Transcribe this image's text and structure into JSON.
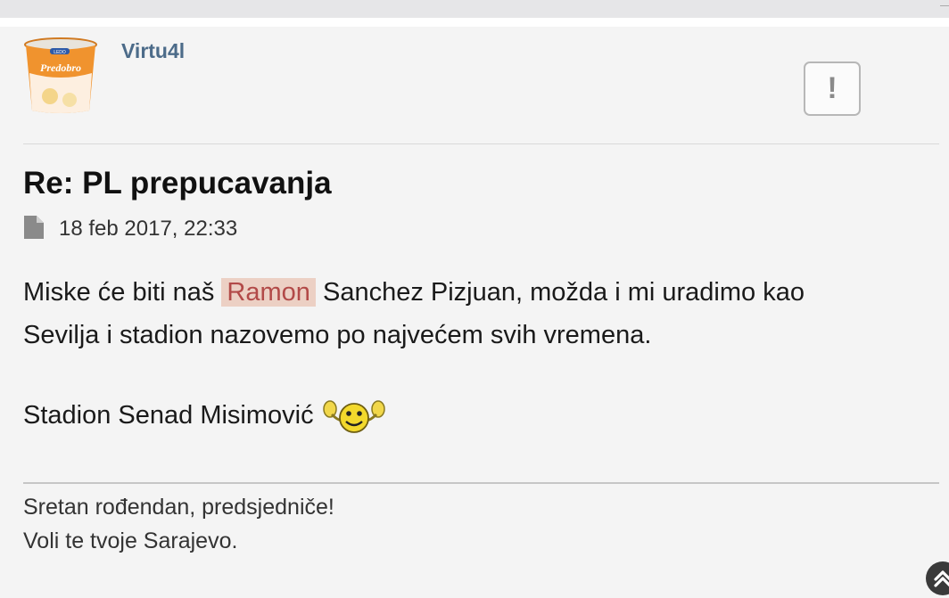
{
  "post": {
    "username": "Virtu4l",
    "report_label": "!",
    "title": "Re: PL prepucavanja",
    "date": "18 feb 2017, 22:33",
    "body": {
      "line1_before": "Miske će biti naš ",
      "line1_highlight": "Ramon",
      "line1_after": " Sanchez Pizjuan, možda i mi uradimo kao",
      "line2": "Sevilja i stadion nazovemo po najvećem svih vremena.",
      "line3": "Stadion Senad Misimović"
    },
    "signature": {
      "line1": "Sretan rođendan, predsjedniče!",
      "line2": "Voli te tvoje Sarajevo."
    },
    "avatar": {
      "brand": "LEDO",
      "product": "Predobro"
    }
  },
  "colors": {
    "username": "#4c6b89",
    "highlight_bg": "#ecd0c4",
    "highlight_text": "#b24a48",
    "post_bg": "#f4f4f4"
  },
  "icons": {
    "meta": "file-icon",
    "smiley": "cheering-smiley-icon",
    "scroll": "scroll-to-top-icon"
  }
}
